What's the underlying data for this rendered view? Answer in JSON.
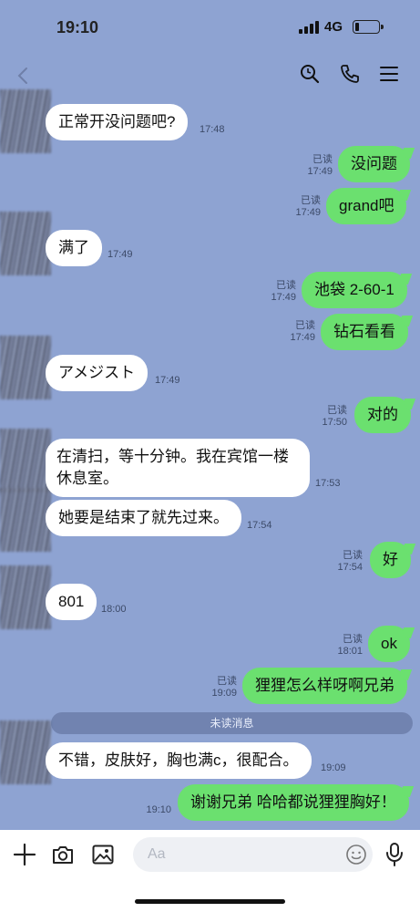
{
  "status_bar": {
    "time": "19:10",
    "network": "4G",
    "battery_level": 0.15
  },
  "nav": {
    "back_icon": "chevron-left-icon",
    "search_icon": "search-icon",
    "call_icon": "phone-icon",
    "menu_icon": "menu-icon"
  },
  "messages": [
    {
      "side": "in",
      "text": "正常开没问题吧?",
      "time": "17:48"
    },
    {
      "side": "out",
      "text": "没问题",
      "read": "已读",
      "time": "17:49"
    },
    {
      "side": "out",
      "text": "grand吧",
      "read": "已读",
      "time": "17:49"
    },
    {
      "side": "in",
      "text": "满了",
      "time": "17:49"
    },
    {
      "side": "out",
      "text": "池袋 2-60-1",
      "read": "已读",
      "time": "17:49"
    },
    {
      "side": "out",
      "text": "钻石看看",
      "read": "已读",
      "time": "17:49"
    },
    {
      "side": "in",
      "text": "アメジスト",
      "time": "17:49"
    },
    {
      "side": "out",
      "text": "对的",
      "read": "已读",
      "time": "17:50"
    },
    {
      "side": "in",
      "text": "在清扫，等十分钟。我在宾馆一楼休息室。",
      "time": "17:53"
    },
    {
      "side": "in",
      "text": "她要是结束了就先过来。",
      "time": "17:54"
    },
    {
      "side": "out",
      "text": "好",
      "read": "已读",
      "time": "17:54"
    },
    {
      "side": "in",
      "text": "801",
      "time": "18:00"
    },
    {
      "side": "out",
      "text": "ok",
      "read": "已读",
      "time": "18:01"
    },
    {
      "side": "out",
      "text": "狸狸怎么样呀啊兄弟",
      "read": "已读",
      "time": "19:09"
    },
    {
      "side": "in",
      "text": "不错，皮肤好，胸也满c，很配合。",
      "time": "19:09"
    },
    {
      "side": "out",
      "text": "谢谢兄弟 哈哈都说狸狸胸好！",
      "time": "19:10"
    }
  ],
  "unread_divider": "未读消息",
  "input_bar": {
    "placeholder": "Aa",
    "add_icon": "plus-icon",
    "camera_icon": "camera-icon",
    "image_icon": "image-icon",
    "emoji_icon": "emoji-icon",
    "mic_icon": "microphone-icon"
  },
  "colors": {
    "background": "#8ea3d2",
    "outgoing_bubble": "#6be06f",
    "incoming_bubble": "#ffffff"
  }
}
